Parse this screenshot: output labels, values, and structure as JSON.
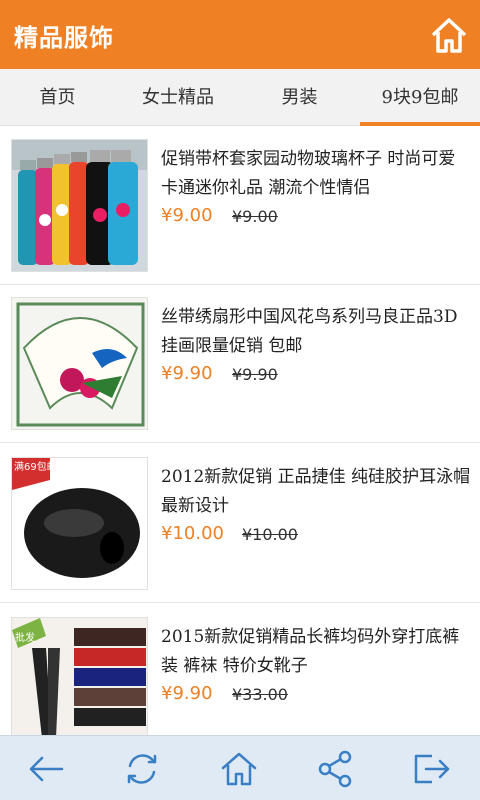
{
  "header": {
    "title": "精品服饰",
    "home_icon": "home-icon"
  },
  "tabs": [
    {
      "label": "首页"
    },
    {
      "label": "女士精品"
    },
    {
      "label": "男装"
    },
    {
      "label": "9块9包邮",
      "active": true
    }
  ],
  "products": [
    {
      "name": "促销带杯套家园动物玻璃杯子 时尚可爱卡通迷你礼品 潮流个性情侣",
      "price": "¥9.00",
      "old_price": "¥9.00"
    },
    {
      "name": "丝带绣扇形中国风花鸟系列马良正品3D挂画限量促销 包邮",
      "price": "¥9.90",
      "old_price": "¥9.90"
    },
    {
      "name": "2012新款促销 正品捷佳 纯硅胶护耳泳帽 最新设计",
      "price": "¥10.00",
      "old_price": "¥10.00",
      "badge": "满69包邮"
    },
    {
      "name": "2015新款促销精品长裤均码外穿打底裤 装 裤袜 特价女靴子",
      "price": "¥9.90",
      "old_price": "¥33.00",
      "badge": "批发"
    }
  ],
  "bottom_bar": {
    "icons": [
      "back-arrow-icon",
      "refresh-icon",
      "home-icon",
      "share-icon",
      "exit-icon"
    ]
  },
  "colors": {
    "accent": "#f08024",
    "bottom_bar": "#dfeaf5"
  }
}
